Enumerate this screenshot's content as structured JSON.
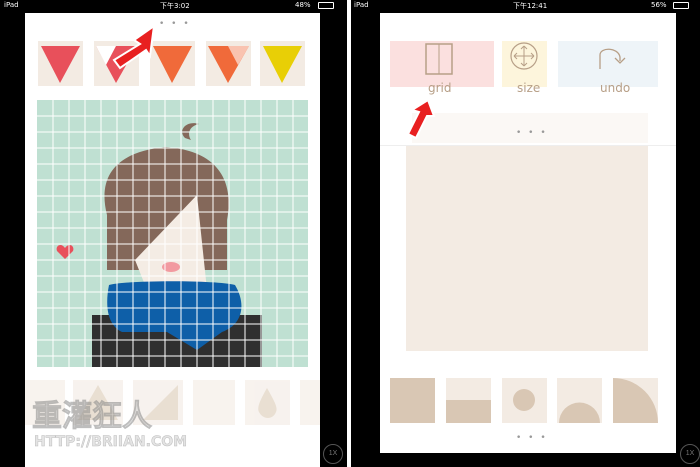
{
  "left": {
    "status": {
      "device": "iPad",
      "time": "下午3:02",
      "battery": "48%"
    },
    "top_dots": "• • •",
    "colors": [
      "#e8505b",
      "#e8505b",
      "#f06a3a",
      "#f06a3a",
      "#e8cf06"
    ],
    "canvas": {
      "grid_color": "#ffffff",
      "background": "#bfe0d2"
    },
    "zoom_label": "1X"
  },
  "right": {
    "status": {
      "device": "iPad",
      "time": "下午12:41",
      "battery": "56%"
    },
    "tools": [
      {
        "label": "grid",
        "icon": "grid-icon",
        "color": "#fbe0df"
      },
      {
        "label": "size",
        "icon": "size-icon",
        "color": "#fdf5dc"
      },
      {
        "label": "undo",
        "icon": "undo-icon",
        "color": "#eef4f8"
      }
    ],
    "mid_dots": "• • •",
    "bottom_dots": "• • •",
    "zoom_label": "1X"
  },
  "watermark": {
    "title": "重灌狂人",
    "url": "HTTP://BRIIAN.COM"
  }
}
